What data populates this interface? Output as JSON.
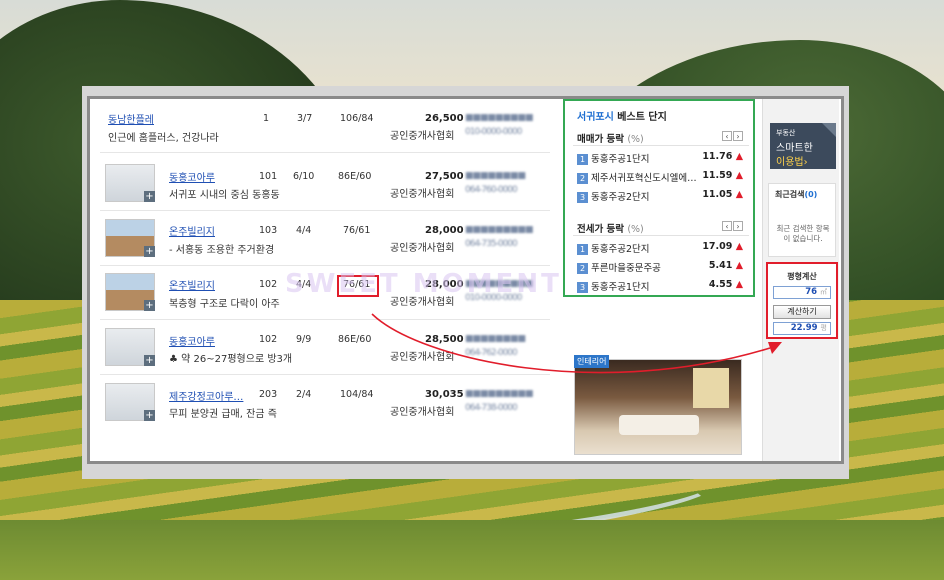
{
  "listings": [
    {
      "name": "동남한플레",
      "desc": "인근에 홈플러스, 건강나라",
      "dong": "1",
      "floor": "3/7",
      "area": "106/84",
      "price": "26,500",
      "agent": "공인중개사협회",
      "phone": "010-0000-0000",
      "thumb": "none"
    },
    {
      "name": "동홍코아루",
      "desc": "서귀포 시내의 중심 동홍동",
      "dong": "101",
      "floor": "6/10",
      "area": "86E/60",
      "price": "27,500",
      "agent": "공인중개사협회",
      "phone": "064-760-0000",
      "thumb": "floorplan"
    },
    {
      "name": "온주빌리지",
      "desc": "- 서홍동 조용한 주거환경",
      "dong": "103",
      "floor": "4/4",
      "area": "76/61",
      "price": "28,000",
      "agent": "공인중개사협회",
      "phone": "064-735-0000",
      "thumb": "building"
    },
    {
      "name": "온주빌리지",
      "desc": "복층형 구조로 다락이 아주",
      "dong": "102",
      "floor": "4/4",
      "area": "76/61",
      "price": "28,000",
      "agent": "공인중개사협회",
      "phone": "010-0000-0000",
      "thumb": "building"
    },
    {
      "name": "동홍코아루",
      "desc": "♣ 약 26~27평형으로 방3개",
      "dong": "102",
      "floor": "9/9",
      "area": "86E/60",
      "price": "28,500",
      "agent": "공인중개사협회",
      "phone": "064-762-0000",
      "thumb": "floorplan"
    },
    {
      "name": "제주강정코아루…",
      "desc": "무피 분양권 급매, 잔금 즉",
      "dong": "203",
      "floor": "2/4",
      "area": "104/84",
      "price": "30,035",
      "agent": "공인중개사협회",
      "phone": "064-738-0000",
      "thumb": "floorplan"
    }
  ],
  "best": {
    "location": "서귀포시",
    "title_rest": " 베스트 단지",
    "sale": {
      "label": "매매가 등락",
      "unit": "(%)",
      "items": [
        {
          "rank": "1",
          "name": "동홍주공1단지",
          "rate": "11.76"
        },
        {
          "rank": "2",
          "name": "제주서귀포혁신도시엘에…",
          "rate": "11.59"
        },
        {
          "rank": "3",
          "name": "동홍주공2단지",
          "rate": "11.05"
        }
      ]
    },
    "jeonse": {
      "label": "전세가 등락",
      "unit": "(%)",
      "items": [
        {
          "rank": "1",
          "name": "동홍주공2단지",
          "rate": "17.09"
        },
        {
          "rank": "2",
          "name": "푸른마을중문주공",
          "rate": "5.41"
        },
        {
          "rank": "3",
          "name": "동홍주공1단지",
          "rate": "4.55"
        }
      ]
    },
    "up_glyph": "▲",
    "prev": "‹",
    "next": "›"
  },
  "ad": {
    "label": "인테리어"
  },
  "sidebar": {
    "smart_l1": "부동산",
    "smart_l2": "스마트한",
    "smart_l3": "이용법›",
    "recent_title": "최근검색",
    "recent_count": "(0)",
    "recent_msg": "최근 검색한 항목이 없습니다.",
    "calc_title": "평형계산",
    "calc_input1": "76",
    "calc_unit1": "㎡",
    "calc_button": "계산하기",
    "calc_input2": "22.99",
    "calc_unit2": "평"
  },
  "watermark": "SWEET MOMENT",
  "colors": {
    "highlight": "#e11d2b",
    "best_border": "#34a853",
    "link": "#1f4fb3"
  }
}
